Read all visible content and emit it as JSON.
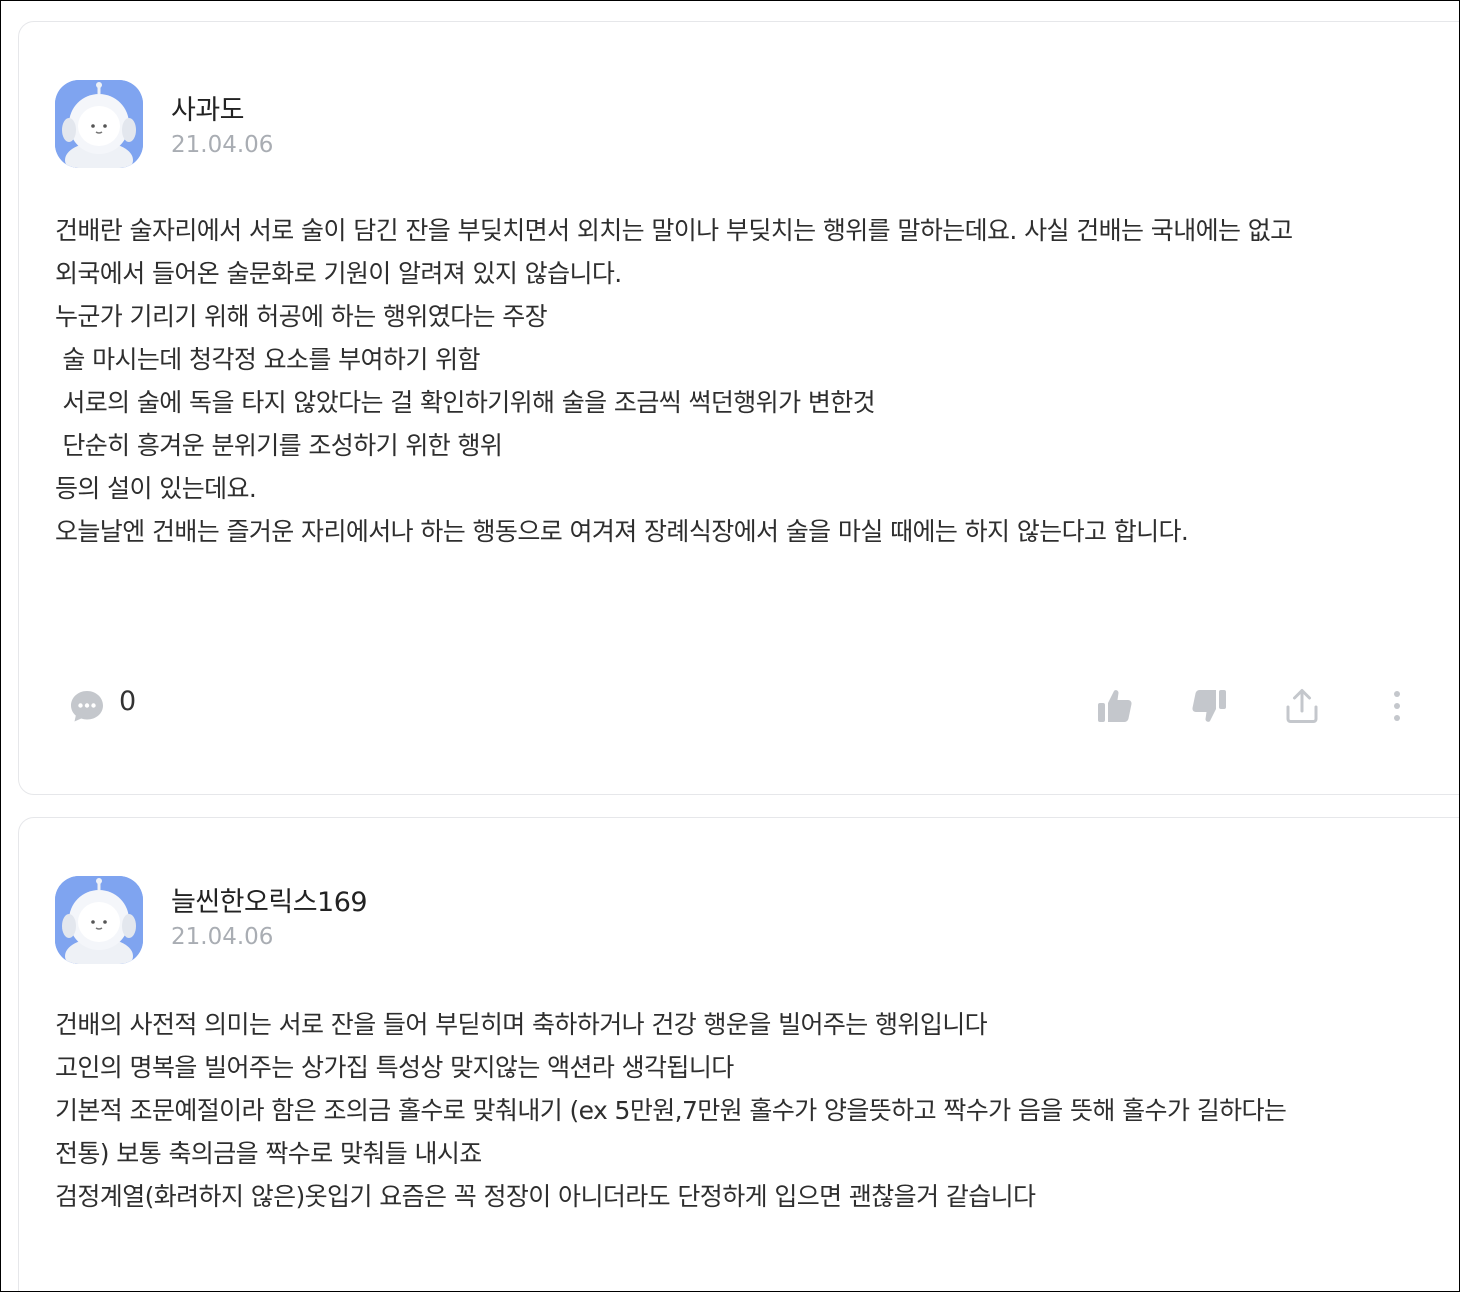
{
  "posts": [
    {
      "author": "사과도",
      "date": "21.04.06",
      "lines": [
        "건배란 술자리에서 서로 술이 담긴 잔을 부딪치면서 외치는 말이나 부딪치는 행위를 말하는데요. 사실 건배는 국내에는 없고",
        "외국에서 들어온 술문화로 기원이 알려져 있지 않습니다.",
        "누군가 기리기 위해 허공에 하는 행위였다는 주장",
        " 술 마시는데 청각정 요소를 부여하기 위함",
        " 서로의 술에 독을 타지 않았다는 걸 확인하기위해 술을 조금씩 썩던행위가 변한것",
        " 단순히 흥겨운 분위기를 조성하기 위한 행위",
        "등의 설이 있는데요.",
        "오늘날엔 건배는 즐거운 자리에서나 하는 행동으로 여겨져 장례식장에서 술을 마실 때에는 하지 않는다고 합니다."
      ],
      "comment_count": "0"
    },
    {
      "author": "늘씬한오릭스169",
      "date": "21.04.06",
      "lines": [
        "건배의 사전적 의미는 서로 잔을 들어 부딛히며 축하하거나 건강 행운을 빌어주는 행위입니다",
        "고인의 명복을 빌어주는 상가집 특성상 맞지않는 액션라 생각됩니다",
        "기본적 조문예절이라 함은 조의금 홀수로 맞춰내기 (ex 5만원,7만원 홀수가 양을뜻하고 짝수가 음을 뜻해 홀수가 길하다는",
        "전통) 보통 축의금을 짝수로 맞춰들 내시죠",
        "검정계열(화려하지 않은)옷입기 요즘은 꼭 정장이 아니더라도 단정하게 입으면 괜찮을거 같습니다"
      ]
    }
  ],
  "icons": {
    "avatar": "robot-avatar-icon",
    "comment": "speech-bubble-icon",
    "like": "thumbs-up-icon",
    "dislike": "thumbs-down-icon",
    "share": "share-upload-icon",
    "more": "more-vertical-icon"
  },
  "colors": {
    "avatar_bg": "#7fa4f0",
    "icon_gray": "#c4c7cc",
    "date_gray": "#a9adb3",
    "text": "#2e2e2e"
  }
}
